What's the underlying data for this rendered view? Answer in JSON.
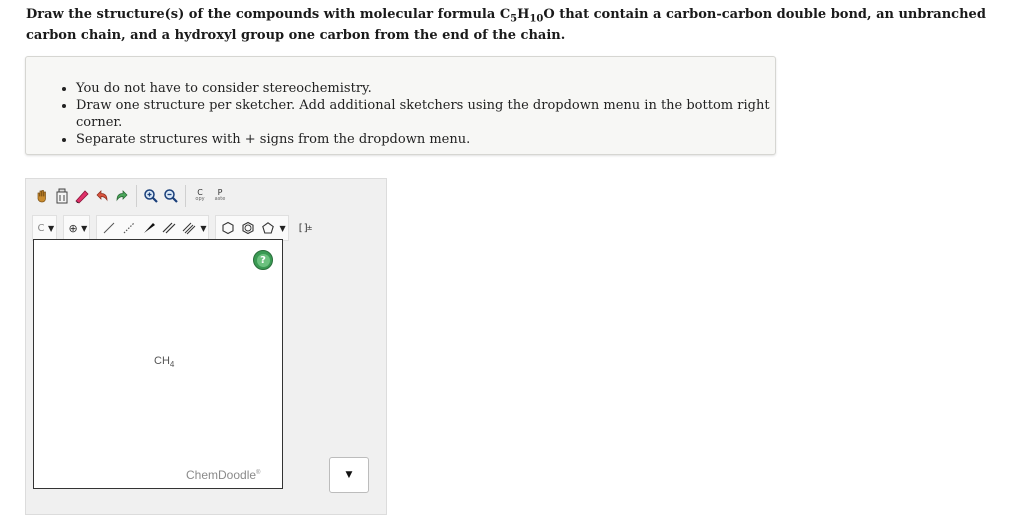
{
  "question": {
    "text_before": "Draw the structure(s) of the compounds with molecular formula C",
    "sub1": "5",
    "text_mid": "H",
    "sub2": "10",
    "text_after": "O that contain a carbon-carbon double bond, an unbranched carbon chain, and a hydroxyl group one carbon from the end of the chain."
  },
  "notes": [
    "You do not have to consider stereochemistry.",
    "Draw one structure per sketcher. Add additional sketchers using the dropdown menu in the bottom right corner.",
    "Separate structures with + signs from the dropdown menu."
  ],
  "sketcher": {
    "toolbar_row1": [
      {
        "name": "hand-icon"
      },
      {
        "name": "erase-icon"
      },
      {
        "name": "clear-icon"
      },
      {
        "name": "undo-icon"
      },
      {
        "name": "redo-icon"
      },
      {
        "name": "zoom-in-icon"
      },
      {
        "name": "zoom-out-icon"
      },
      {
        "name": "copy-icon",
        "label_top": "C",
        "label_bottom": "opy"
      },
      {
        "name": "paste-icon",
        "label_top": "P",
        "label_bottom": "aste"
      }
    ],
    "toolbar_row2": {
      "element_label": "C",
      "charge_label": "⊕",
      "template_label": "[ ]",
      "template_sup": "±"
    },
    "canvas": {
      "molecule_label": "CH",
      "molecule_sub": "4",
      "help_label": "?",
      "watermark": "ChemDoodle",
      "watermark_mark": "®"
    },
    "dropdown_arrow": "▼"
  },
  "colors": {
    "help_green": "#3a9a53",
    "panel_bg": "#f0f0f0",
    "notes_bg": "#f7f7f5"
  }
}
